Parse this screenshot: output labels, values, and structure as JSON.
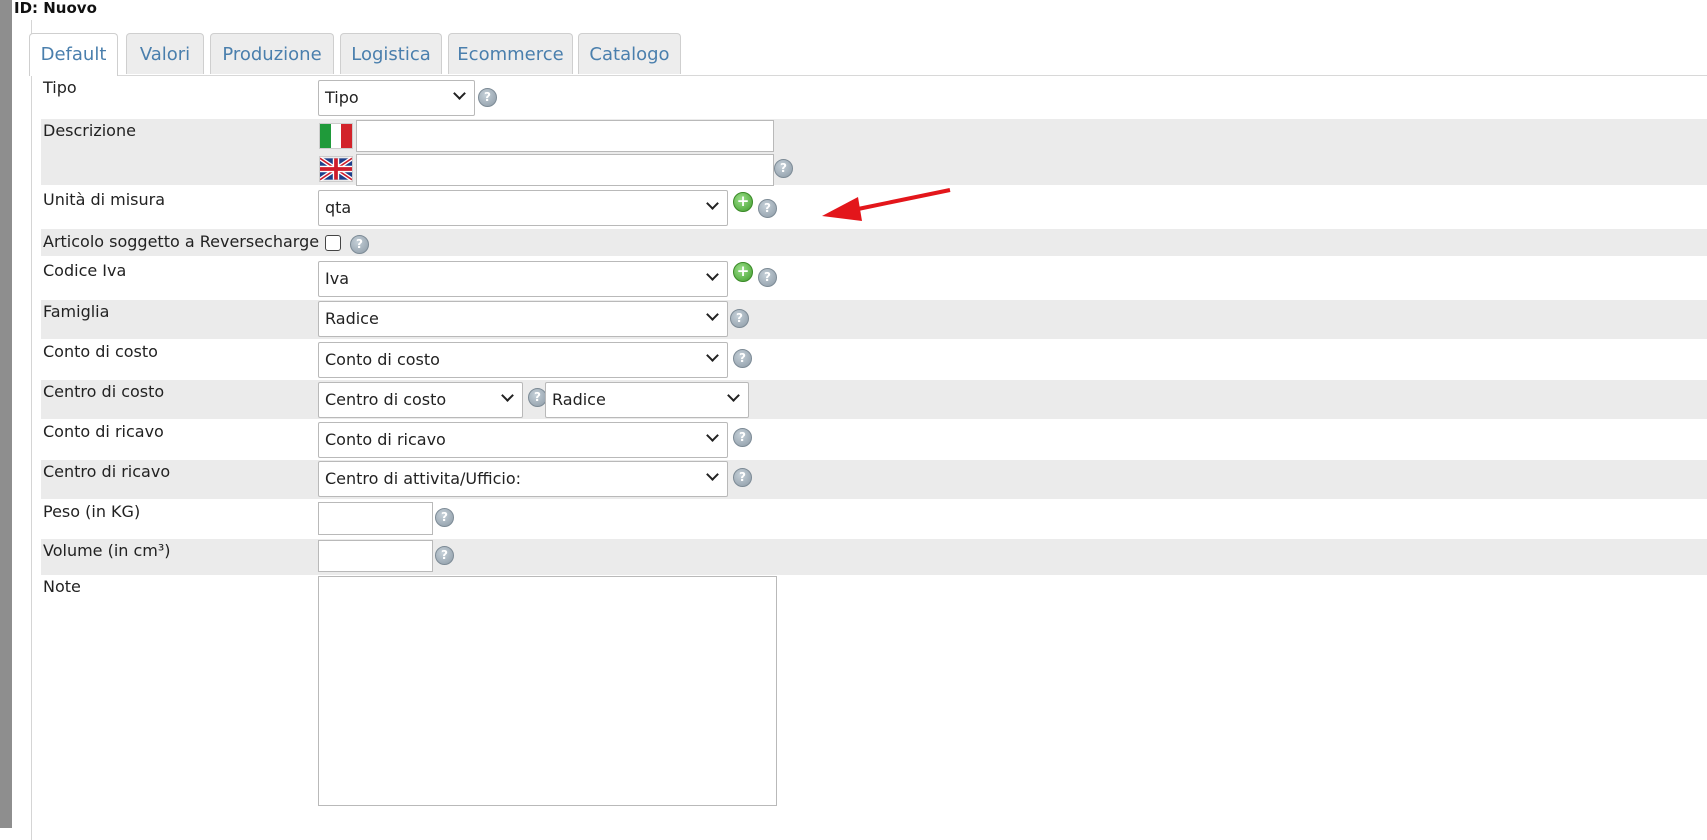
{
  "record": {
    "id_label": "ID: Nuovo"
  },
  "tabs": [
    {
      "label": "Default",
      "active": true
    },
    {
      "label": "Valori"
    },
    {
      "label": "Produzione"
    },
    {
      "label": "Logistica"
    },
    {
      "label": "Ecommerce"
    },
    {
      "label": "Catalogo"
    }
  ],
  "form": {
    "tipo": {
      "label": "Tipo",
      "value": "Tipo"
    },
    "descrizione": {
      "label": "Descrizione",
      "it_value": "",
      "en_value": ""
    },
    "unita": {
      "label": "Unità di misura",
      "value": "qta"
    },
    "reverse": {
      "label": "Articolo soggetto a Reversecharge",
      "checked": false
    },
    "iva": {
      "label": "Codice Iva",
      "value": "Iva"
    },
    "famiglia": {
      "label": "Famiglia",
      "value": "Radice"
    },
    "conto_costo": {
      "label": "Conto di costo",
      "value": "Conto di costo"
    },
    "centro_costo": {
      "label": "Centro di costo",
      "value": "Centro di costo",
      "value2": "Radice"
    },
    "conto_ricavo": {
      "label": "Conto di ricavo",
      "value": "Conto di ricavo"
    },
    "centro_ricavo": {
      "label": "Centro di ricavo",
      "value": "Centro di attivita/Ufficio:"
    },
    "peso": {
      "label": "Peso (in KG)",
      "value": ""
    },
    "volume": {
      "label": "Volume (in cm³)",
      "value": ""
    },
    "note": {
      "label": "Note",
      "value": ""
    }
  },
  "icons": {
    "help": "question-circle-icon",
    "add": "plus-circle-icon",
    "dropdown": "chevron-down-icon",
    "annotation": "red-arrow"
  },
  "colors": {
    "tab_text": "#4a7fad",
    "row_alt": "#ebebeb",
    "add_green": "#3f9b2b",
    "arrow_red": "#e3161b"
  }
}
